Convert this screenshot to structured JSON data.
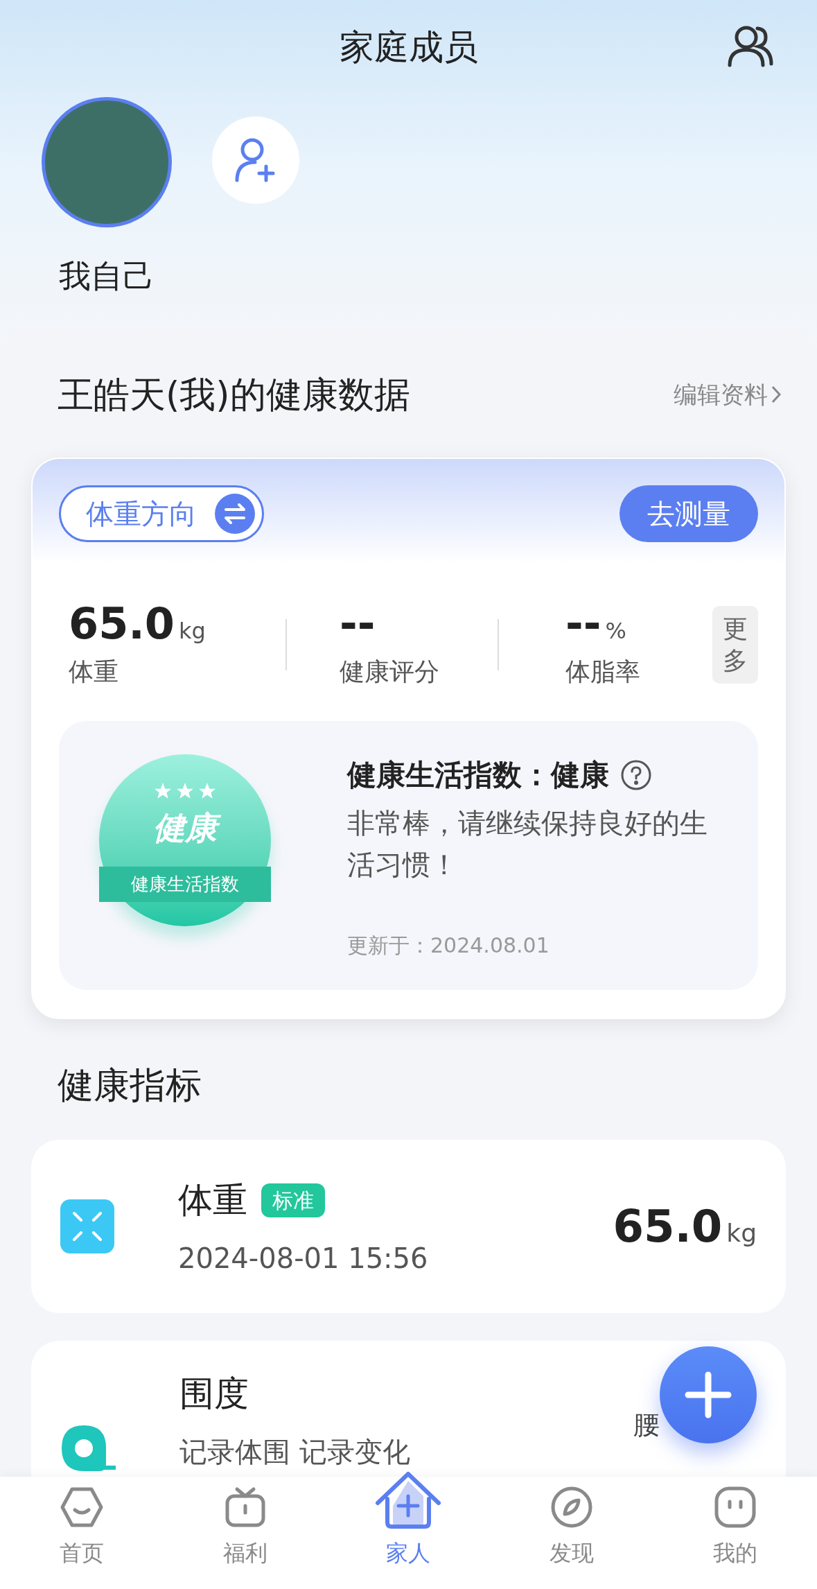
{
  "header": {
    "title": "家庭成员"
  },
  "members": [
    {
      "name": "我自己",
      "selected": true
    }
  ],
  "health": {
    "title": "王皓天(我)的健康数据",
    "edit_link": "编辑资料",
    "mode_chip": "体重方向",
    "measure_button": "去测量",
    "stats": [
      {
        "value": "65.0",
        "unit": "kg",
        "label": "体重"
      },
      {
        "value": "--",
        "label": "健康评分"
      },
      {
        "value": "--",
        "unit": "%",
        "label": "体脂率"
      }
    ],
    "more_button": "更多",
    "lifestyle": {
      "badge_title": "健康",
      "badge_caption": "健康生活指数",
      "stars": 3,
      "title": "健康生活指数：健康",
      "message": "非常棒，请继续保持良好的生活习惯！",
      "updated": "更新于：2024.08.01"
    }
  },
  "indicators": {
    "title": "健康指标",
    "items": [
      {
        "kind": "weight",
        "name": "体重",
        "tag": "标准",
        "subtitle": "2024-08-01 15:56",
        "value": "65.0",
        "unit": "kg"
      },
      {
        "kind": "girth",
        "name": "围度",
        "subtitle": "记录体围 记录变化",
        "value": "腰"
      }
    ]
  },
  "tabs": [
    {
      "label": "首页",
      "selected": false
    },
    {
      "label": "福利",
      "selected": false
    },
    {
      "label": "家人",
      "selected": true
    },
    {
      "label": "发现",
      "selected": false
    },
    {
      "label": "我的",
      "selected": false
    }
  ]
}
